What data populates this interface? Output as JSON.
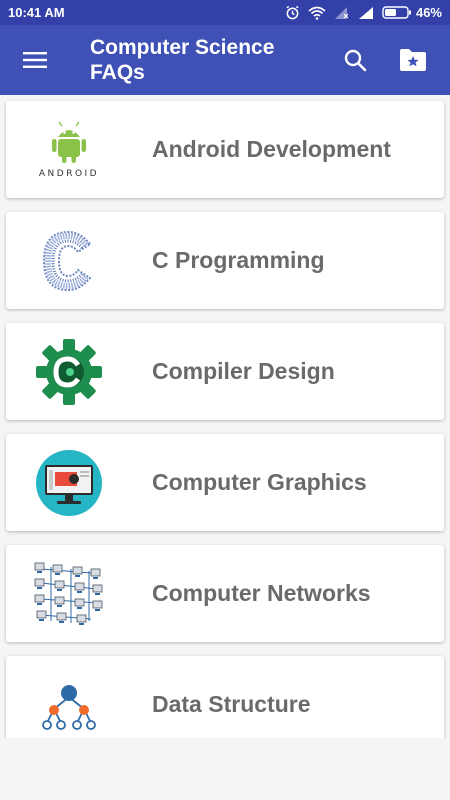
{
  "status_bar": {
    "time": "10:41 AM",
    "battery": "46%",
    "icons": [
      "alarm-icon",
      "wifi-icon",
      "no-signal-icon",
      "signal-icon",
      "battery-icon"
    ]
  },
  "app_bar": {
    "title": "Computer Science FAQs",
    "menu_icon": "menu-icon",
    "search_icon": "search-icon",
    "folder_icon": "starred-folder-icon"
  },
  "topics": [
    {
      "label": "Android Development",
      "icon": "android-icon",
      "icon_text": "ANDROID"
    },
    {
      "label": "C Programming",
      "icon": "c-language-icon"
    },
    {
      "label": "Compiler Design",
      "icon": "compiler-gear-icon"
    },
    {
      "label": "Computer Graphics",
      "icon": "monitor-graphics-icon"
    },
    {
      "label": "Computer Networks",
      "icon": "network-computers-icon"
    },
    {
      "label": "Data Structure",
      "icon": "tree-structure-icon"
    }
  ],
  "colors": {
    "primary": "#3f51b5",
    "status_bar": "#3340a8",
    "label_text": "#6a6a6a",
    "android_green": "#8bc34a",
    "compiler_green": "#1e8e4e",
    "graphics_teal": "#26b5c4",
    "tree_orange": "#f26b2a",
    "tree_blue": "#2f6aa8"
  }
}
